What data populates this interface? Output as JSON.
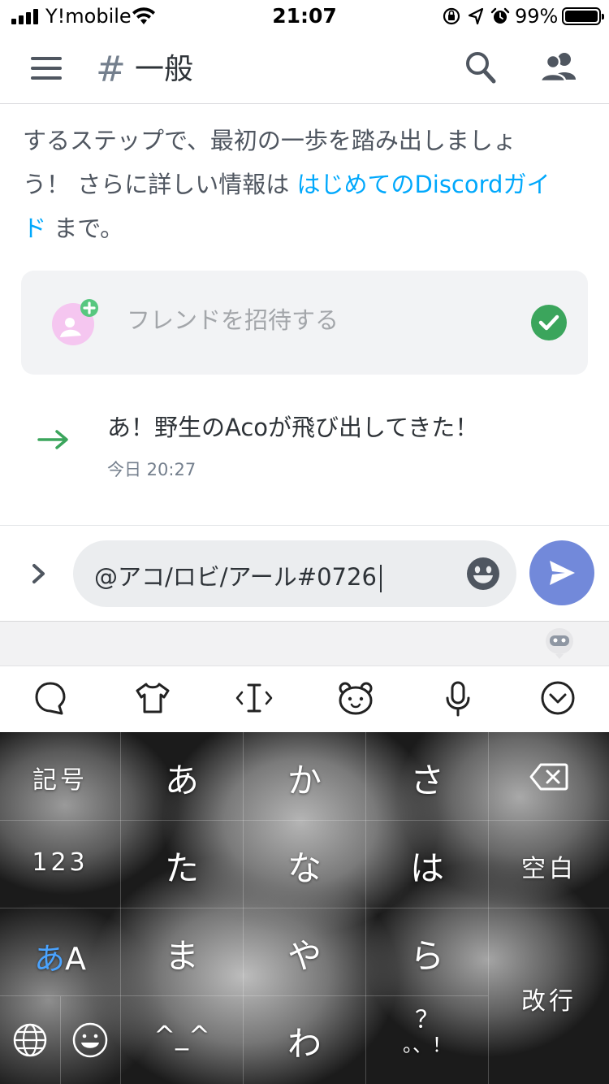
{
  "status_bar": {
    "carrier": "Y!mobile",
    "time": "21:07",
    "battery": "99%"
  },
  "header": {
    "hash": "#",
    "channel_name": "一般"
  },
  "messages": {
    "intro_prefix_line1": "するステップで、最初の一歩を踏み出しましょ",
    "intro_prefix_line2": "う！ さらに詳しい情報は ",
    "intro_link_line2": "はじめてのDiscordガイ",
    "intro_link_line3": "ド",
    "intro_suffix_line3": " まで。",
    "invite_label": "フレンドを招待する",
    "join_text": "あ！野生のAcoが飛び出してきた！",
    "join_time": "今日 20:27"
  },
  "composer": {
    "input_value": "@アコ/ロビ/アール#0726"
  },
  "keyboard": {
    "row1": [
      "記号",
      "あ",
      "か",
      "さ"
    ],
    "row2": [
      "123",
      "た",
      "な",
      "は",
      "空白"
    ],
    "row3_aa_a": "あ",
    "row3_aa_b": "A",
    "row3": [
      "ま",
      "や",
      "ら"
    ],
    "row4_face": "^_^",
    "row4_wa": "わ",
    "row4_punct_top": "？",
    "row4_punct_bottom": "。、！",
    "return_label": "改行"
  },
  "colors": {
    "accent_blurple": "#7289da",
    "link": "#00a8fc",
    "join_green": "#3ba55c",
    "check_green": "#3ba55c"
  }
}
